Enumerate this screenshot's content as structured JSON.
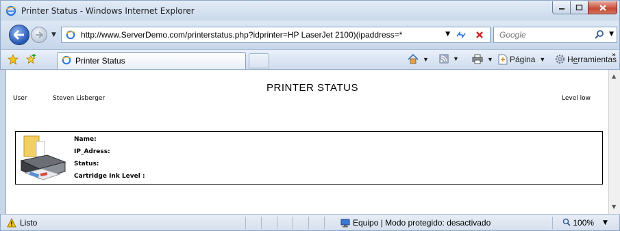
{
  "window": {
    "title": "Printer Status - Windows Internet Explorer"
  },
  "address_bar": {
    "url": "http://www.ServerDemo.com/printerstatus.php?idprinter=HP LaserJet 2100)(ipaddress=*"
  },
  "search": {
    "placeholder": "Google"
  },
  "tab": {
    "label": "Printer Status"
  },
  "commands": {
    "page": "Página",
    "tools_prefix": "H",
    "tools_underlined": "e",
    "tools_rest": "rramientas"
  },
  "page": {
    "title": "PRINTER STATUS",
    "user_label": "User",
    "user_name": "Steven Lisberger",
    "level": "Level low",
    "fields": {
      "name": "Name:",
      "ip": "IP_Adress:",
      "status": "Status:",
      "ink": "Cartridge Ink Level :"
    }
  },
  "statusbar": {
    "status": "Listo",
    "zone": "Equipo | Modo protegido: desactivado",
    "zoom": "100%"
  },
  "colors": {
    "close_button": "#c64a35",
    "back_button": "#2456b3"
  }
}
